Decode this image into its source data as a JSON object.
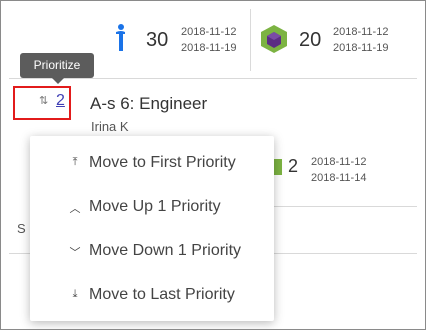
{
  "header": {
    "stat1": {
      "icon": "info-icon",
      "value": "30",
      "date_start": "2018-11-12",
      "date_end": "2018-11-19"
    },
    "stat2": {
      "icon": "hexagon-cube-icon",
      "value": "20",
      "date_start": "2018-11-12",
      "date_end": "2018-11-19"
    }
  },
  "tooltip": "Prioritize",
  "task": {
    "priority": "2",
    "title": "A-s 6: Engineer",
    "assignee": "Irina K",
    "value": "2",
    "date_start": "2018-11-12",
    "date_end": "2018-11-14"
  },
  "partial_text": "S",
  "menu": [
    {
      "icon": "move-to-top-icon",
      "label": "Move to First Priority"
    },
    {
      "icon": "chevron-up-icon",
      "label": "Move Up 1 Priority"
    },
    {
      "icon": "chevron-down-icon",
      "label": "Move Down 1 Priority"
    },
    {
      "icon": "move-to-bottom-icon",
      "label": "Move to Last Priority"
    }
  ],
  "colors": {
    "accent_blue": "#1a73e8",
    "badge_green": "#7cb342",
    "cube_purple": "#5b2d83",
    "highlight_red": "#e21b1b"
  }
}
